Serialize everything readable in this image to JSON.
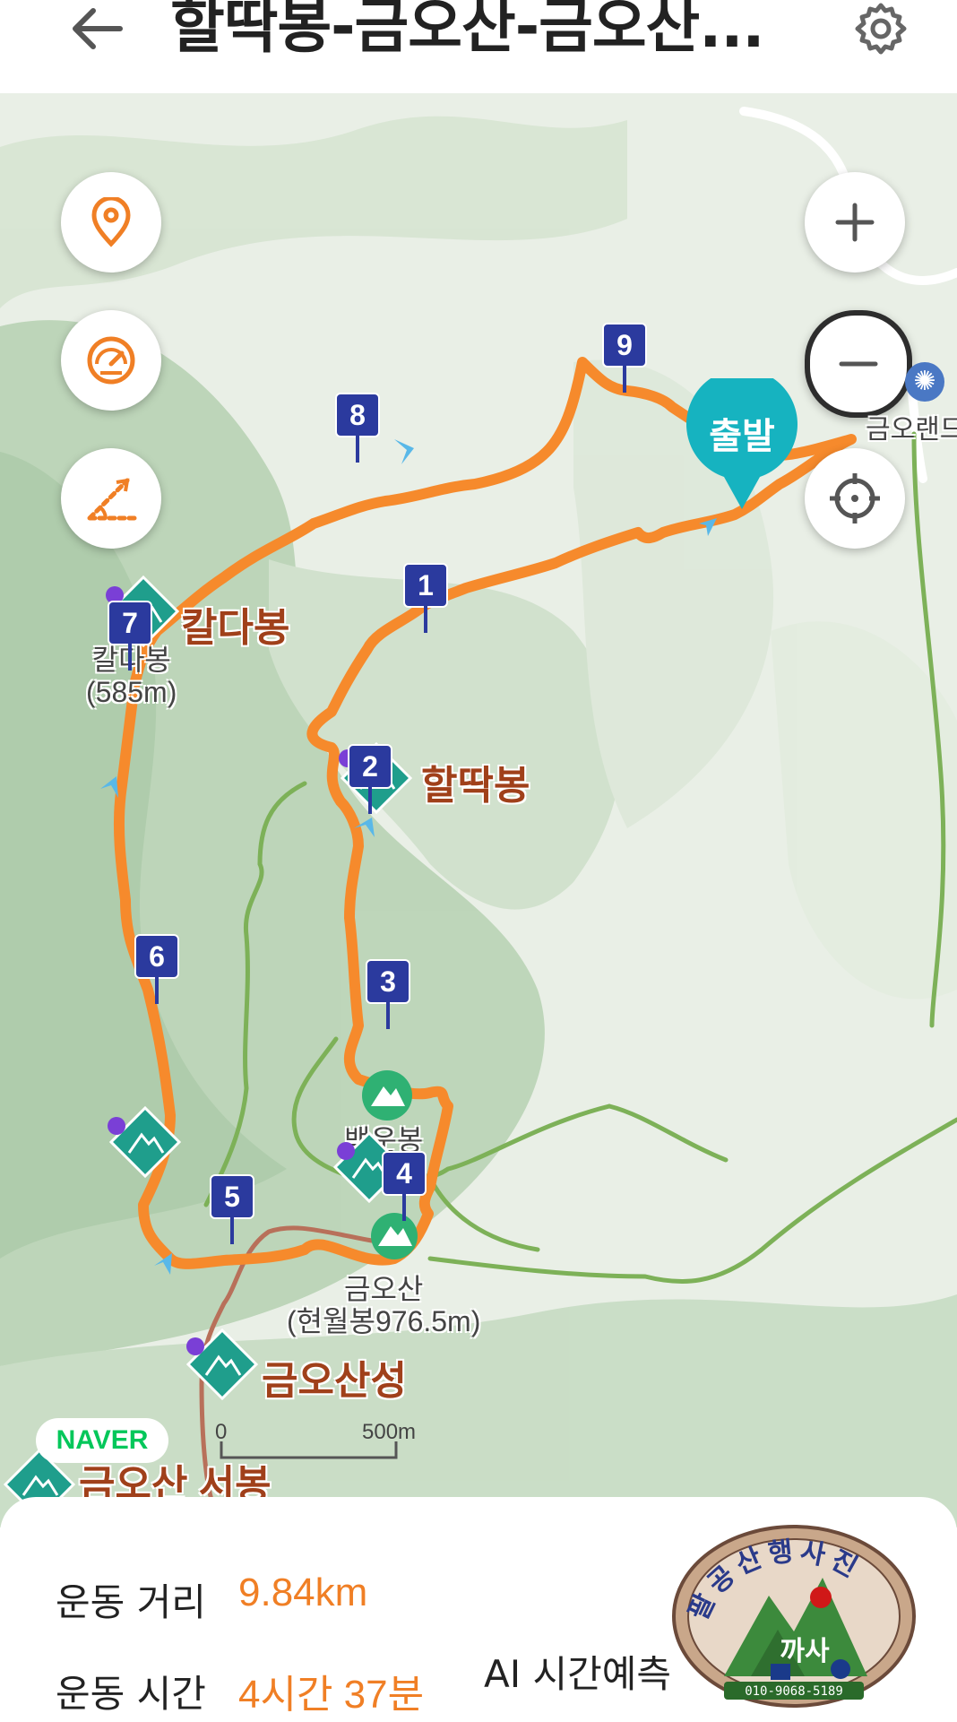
{
  "header": {
    "title": "할딱봉-금오산-금오산...",
    "back_icon": "arrow-left-icon",
    "settings_icon": "gear-icon"
  },
  "map": {
    "start_marker": "출발",
    "scale": {
      "zero": "0",
      "distance": "500m"
    },
    "provider": "NAVER",
    "place_label": "금오랜드",
    "peaks": [
      {
        "name": "칼다봉",
        "sub": "칼다봉\n(585m)"
      },
      {
        "name": "할딱봉"
      },
      {
        "name": "백운봉"
      },
      {
        "name": "금오산",
        "sub": "금오산\n(현월봉976.5m)"
      },
      {
        "name": "금오산성"
      },
      {
        "name": "금오산 서봉"
      }
    ],
    "waypoints": [
      "1",
      "2",
      "3",
      "4",
      "5",
      "6",
      "7",
      "8",
      "9"
    ],
    "controls": {
      "location_pin": "location-pin-icon",
      "speedometer": "speedometer-icon",
      "slope": "slope-icon",
      "zoom_in": "plus-icon",
      "zoom_out": "minus-icon",
      "recenter": "crosshair-icon"
    }
  },
  "stats": {
    "distance_label": "운동 거리",
    "distance_value": "9.84km",
    "time_label": "운동 시간",
    "time_value": "4시간 37분",
    "ai_label": "AI 시간예측"
  },
  "logo": {
    "text": "팔공산행사진",
    "short": "까사",
    "phone": "010-9068-5189"
  },
  "colors": {
    "route": "#f68a2c",
    "accent": "#f07f25",
    "start_marker": "#16b3c0",
    "waypoint": "#2b3a9e"
  }
}
